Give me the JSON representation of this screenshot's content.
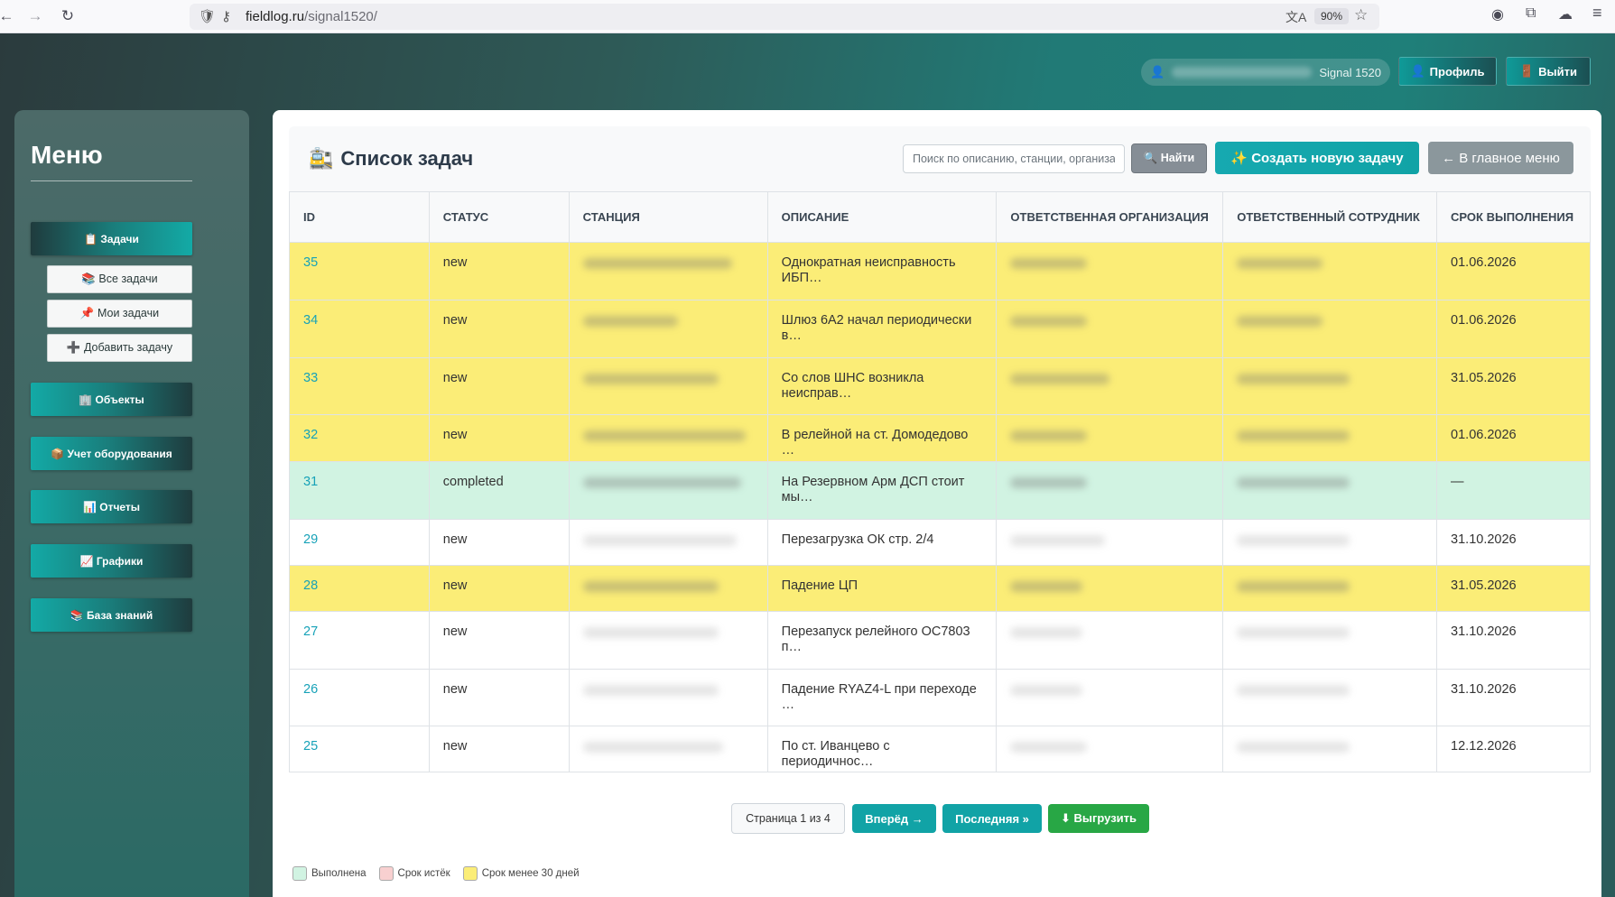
{
  "browser": {
    "url_host": "fieldlog.ru",
    "url_path": "/signal1520/",
    "zoom": "90%"
  },
  "header": {
    "user_label": "Signal 1520",
    "profile_label": "Профиль",
    "logout_label": "Выйти"
  },
  "sidebar": {
    "title": "Меню",
    "tasks_label": "📋 Задачи",
    "sub_items": [
      {
        "label": "📚 Все задачи"
      },
      {
        "label": "📌 Мои задачи"
      },
      {
        "label": "➕ Добавить задачу"
      }
    ],
    "items": [
      {
        "label": "🏢 Объекты"
      },
      {
        "label": "📦 Учет оборудования"
      },
      {
        "label": "📊 Отчеты"
      },
      {
        "label": "📈 Графики"
      },
      {
        "label": "📚 База знаний"
      }
    ]
  },
  "main": {
    "title": "Список задач",
    "title_icon": "🚉",
    "search_placeholder": "Поиск по описанию, станции, организации",
    "find_label": "🔍 Найти",
    "create_label": "✨ Создать новую задачу",
    "home_label": "← В главное меню"
  },
  "table": {
    "headers": {
      "id": "ID",
      "status": "Статус",
      "station": "Станция",
      "description": "Описание",
      "org": "Ответственная организация",
      "employee": "Ответственный сотрудник",
      "deadline": "Срок выполнения"
    },
    "rows": [
      {
        "id": "35",
        "status": "new",
        "description": "Однократная неисправность ИБП…",
        "deadline": "01.06.2026",
        "highlight": "yellow"
      },
      {
        "id": "34",
        "status": "new",
        "description": "Шлюз 6А2 начал периодически в…",
        "deadline": "01.06.2026",
        "highlight": "yellow"
      },
      {
        "id": "33",
        "status": "new",
        "description": "Со слов ШНС возникла неисправ…",
        "deadline": "31.05.2026",
        "highlight": "yellow"
      },
      {
        "id": "32",
        "status": "new",
        "description": "В релейной на ст. Домодедово …",
        "deadline": "01.06.2026",
        "highlight": "yellow"
      },
      {
        "id": "31",
        "status": "completed",
        "description": "На Резервном Арм ДСП стоит мы…",
        "deadline": "—",
        "highlight": "green"
      },
      {
        "id": "29",
        "status": "new",
        "description": "Перезагрузка ОК стр. 2/4",
        "deadline": "31.10.2026",
        "highlight": "white"
      },
      {
        "id": "28",
        "status": "new",
        "description": "Падение ЦП",
        "deadline": "31.05.2026",
        "highlight": "yellow"
      },
      {
        "id": "27",
        "status": "new",
        "description": "Перезапуск релейного ОС7803 п…",
        "deadline": "31.10.2026",
        "highlight": "white"
      },
      {
        "id": "26",
        "status": "new",
        "description": "Падение RYAZ4-L при переходе …",
        "deadline": "31.10.2026",
        "highlight": "white"
      },
      {
        "id": "25",
        "status": "new",
        "description": "По ст. Иванцево с периодичнос…",
        "deadline": "12.12.2026",
        "highlight": "white"
      }
    ]
  },
  "pagination": {
    "info": "Страница 1 из 4",
    "next_label": "Вперёд →",
    "last_label": "Последняя »",
    "export_label": "⬇ Выгрузить"
  },
  "legend": [
    {
      "label": "Выполнена",
      "color": "#d1f3e2"
    },
    {
      "label": "Срок истёк",
      "color": "#f8d0d0"
    },
    {
      "label": "Срок менее 30 дней",
      "color": "#fbed77"
    }
  ],
  "colors": {
    "accent": "#11a3a6",
    "row_yellow": "#fbed77",
    "row_green": "#d1f3e2",
    "id_link": "#17a2b8",
    "export_green": "#28a745"
  }
}
